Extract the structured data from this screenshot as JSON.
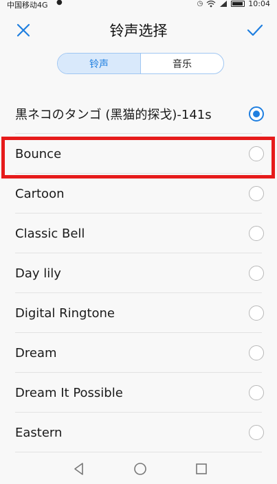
{
  "status_bar": {
    "carrier": "中国移动4G",
    "time": "10:04"
  },
  "header": {
    "title": "铃声选择",
    "close_icon": "close-icon",
    "confirm_icon": "checkmark-icon"
  },
  "tabs": [
    {
      "label": "铃声",
      "active": true
    },
    {
      "label": "音乐",
      "active": false
    }
  ],
  "ringtones": [
    {
      "label": "黒ネコのタンゴ (黑猫的探戈)-141s",
      "selected": true
    },
    {
      "label": "Bounce",
      "selected": false
    },
    {
      "label": "Cartoon",
      "selected": false
    },
    {
      "label": "Classic Bell",
      "selected": false
    },
    {
      "label": "Day lily",
      "selected": false
    },
    {
      "label": "Digital Ringtone",
      "selected": false
    },
    {
      "label": "Dream",
      "selected": false
    },
    {
      "label": "Dream It Possible",
      "selected": false
    },
    {
      "label": "Eastern",
      "selected": false
    }
  ],
  "colors": {
    "accent": "#1f7fe0",
    "highlight": "#e61b1b"
  },
  "nav_bar": [
    "back-icon",
    "home-icon",
    "recents-icon"
  ]
}
